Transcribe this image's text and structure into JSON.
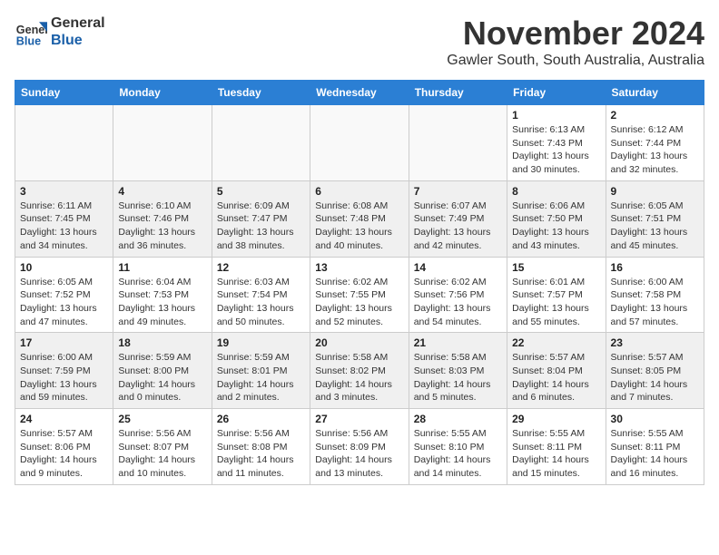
{
  "header": {
    "logo_general": "General",
    "logo_blue": "Blue",
    "month": "November 2024",
    "location": "Gawler South, South Australia, Australia"
  },
  "days_of_week": [
    "Sunday",
    "Monday",
    "Tuesday",
    "Wednesday",
    "Thursday",
    "Friday",
    "Saturday"
  ],
  "weeks": [
    [
      {
        "day": "",
        "empty": true
      },
      {
        "day": "",
        "empty": true
      },
      {
        "day": "",
        "empty": true
      },
      {
        "day": "",
        "empty": true
      },
      {
        "day": "",
        "empty": true
      },
      {
        "day": "1",
        "sunrise": "6:13 AM",
        "sunset": "7:43 PM",
        "daylight": "13 hours and 30 minutes."
      },
      {
        "day": "2",
        "sunrise": "6:12 AM",
        "sunset": "7:44 PM",
        "daylight": "13 hours and 32 minutes."
      }
    ],
    [
      {
        "day": "3",
        "sunrise": "6:11 AM",
        "sunset": "7:45 PM",
        "daylight": "13 hours and 34 minutes."
      },
      {
        "day": "4",
        "sunrise": "6:10 AM",
        "sunset": "7:46 PM",
        "daylight": "13 hours and 36 minutes."
      },
      {
        "day": "5",
        "sunrise": "6:09 AM",
        "sunset": "7:47 PM",
        "daylight": "13 hours and 38 minutes."
      },
      {
        "day": "6",
        "sunrise": "6:08 AM",
        "sunset": "7:48 PM",
        "daylight": "13 hours and 40 minutes."
      },
      {
        "day": "7",
        "sunrise": "6:07 AM",
        "sunset": "7:49 PM",
        "daylight": "13 hours and 42 minutes."
      },
      {
        "day": "8",
        "sunrise": "6:06 AM",
        "sunset": "7:50 PM",
        "daylight": "13 hours and 43 minutes."
      },
      {
        "day": "9",
        "sunrise": "6:05 AM",
        "sunset": "7:51 PM",
        "daylight": "13 hours and 45 minutes."
      }
    ],
    [
      {
        "day": "10",
        "sunrise": "6:05 AM",
        "sunset": "7:52 PM",
        "daylight": "13 hours and 47 minutes."
      },
      {
        "day": "11",
        "sunrise": "6:04 AM",
        "sunset": "7:53 PM",
        "daylight": "13 hours and 49 minutes."
      },
      {
        "day": "12",
        "sunrise": "6:03 AM",
        "sunset": "7:54 PM",
        "daylight": "13 hours and 50 minutes."
      },
      {
        "day": "13",
        "sunrise": "6:02 AM",
        "sunset": "7:55 PM",
        "daylight": "13 hours and 52 minutes."
      },
      {
        "day": "14",
        "sunrise": "6:02 AM",
        "sunset": "7:56 PM",
        "daylight": "13 hours and 54 minutes."
      },
      {
        "day": "15",
        "sunrise": "6:01 AM",
        "sunset": "7:57 PM",
        "daylight": "13 hours and 55 minutes."
      },
      {
        "day": "16",
        "sunrise": "6:00 AM",
        "sunset": "7:58 PM",
        "daylight": "13 hours and 57 minutes."
      }
    ],
    [
      {
        "day": "17",
        "sunrise": "6:00 AM",
        "sunset": "7:59 PM",
        "daylight": "13 hours and 59 minutes."
      },
      {
        "day": "18",
        "sunrise": "5:59 AM",
        "sunset": "8:00 PM",
        "daylight": "14 hours and 0 minutes."
      },
      {
        "day": "19",
        "sunrise": "5:59 AM",
        "sunset": "8:01 PM",
        "daylight": "14 hours and 2 minutes."
      },
      {
        "day": "20",
        "sunrise": "5:58 AM",
        "sunset": "8:02 PM",
        "daylight": "14 hours and 3 minutes."
      },
      {
        "day": "21",
        "sunrise": "5:58 AM",
        "sunset": "8:03 PM",
        "daylight": "14 hours and 5 minutes."
      },
      {
        "day": "22",
        "sunrise": "5:57 AM",
        "sunset": "8:04 PM",
        "daylight": "14 hours and 6 minutes."
      },
      {
        "day": "23",
        "sunrise": "5:57 AM",
        "sunset": "8:05 PM",
        "daylight": "14 hours and 7 minutes."
      }
    ],
    [
      {
        "day": "24",
        "sunrise": "5:57 AM",
        "sunset": "8:06 PM",
        "daylight": "14 hours and 9 minutes."
      },
      {
        "day": "25",
        "sunrise": "5:56 AM",
        "sunset": "8:07 PM",
        "daylight": "14 hours and 10 minutes."
      },
      {
        "day": "26",
        "sunrise": "5:56 AM",
        "sunset": "8:08 PM",
        "daylight": "14 hours and 11 minutes."
      },
      {
        "day": "27",
        "sunrise": "5:56 AM",
        "sunset": "8:09 PM",
        "daylight": "14 hours and 13 minutes."
      },
      {
        "day": "28",
        "sunrise": "5:55 AM",
        "sunset": "8:10 PM",
        "daylight": "14 hours and 14 minutes."
      },
      {
        "day": "29",
        "sunrise": "5:55 AM",
        "sunset": "8:11 PM",
        "daylight": "14 hours and 15 minutes."
      },
      {
        "day": "30",
        "sunrise": "5:55 AM",
        "sunset": "8:11 PM",
        "daylight": "14 hours and 16 minutes."
      }
    ]
  ]
}
